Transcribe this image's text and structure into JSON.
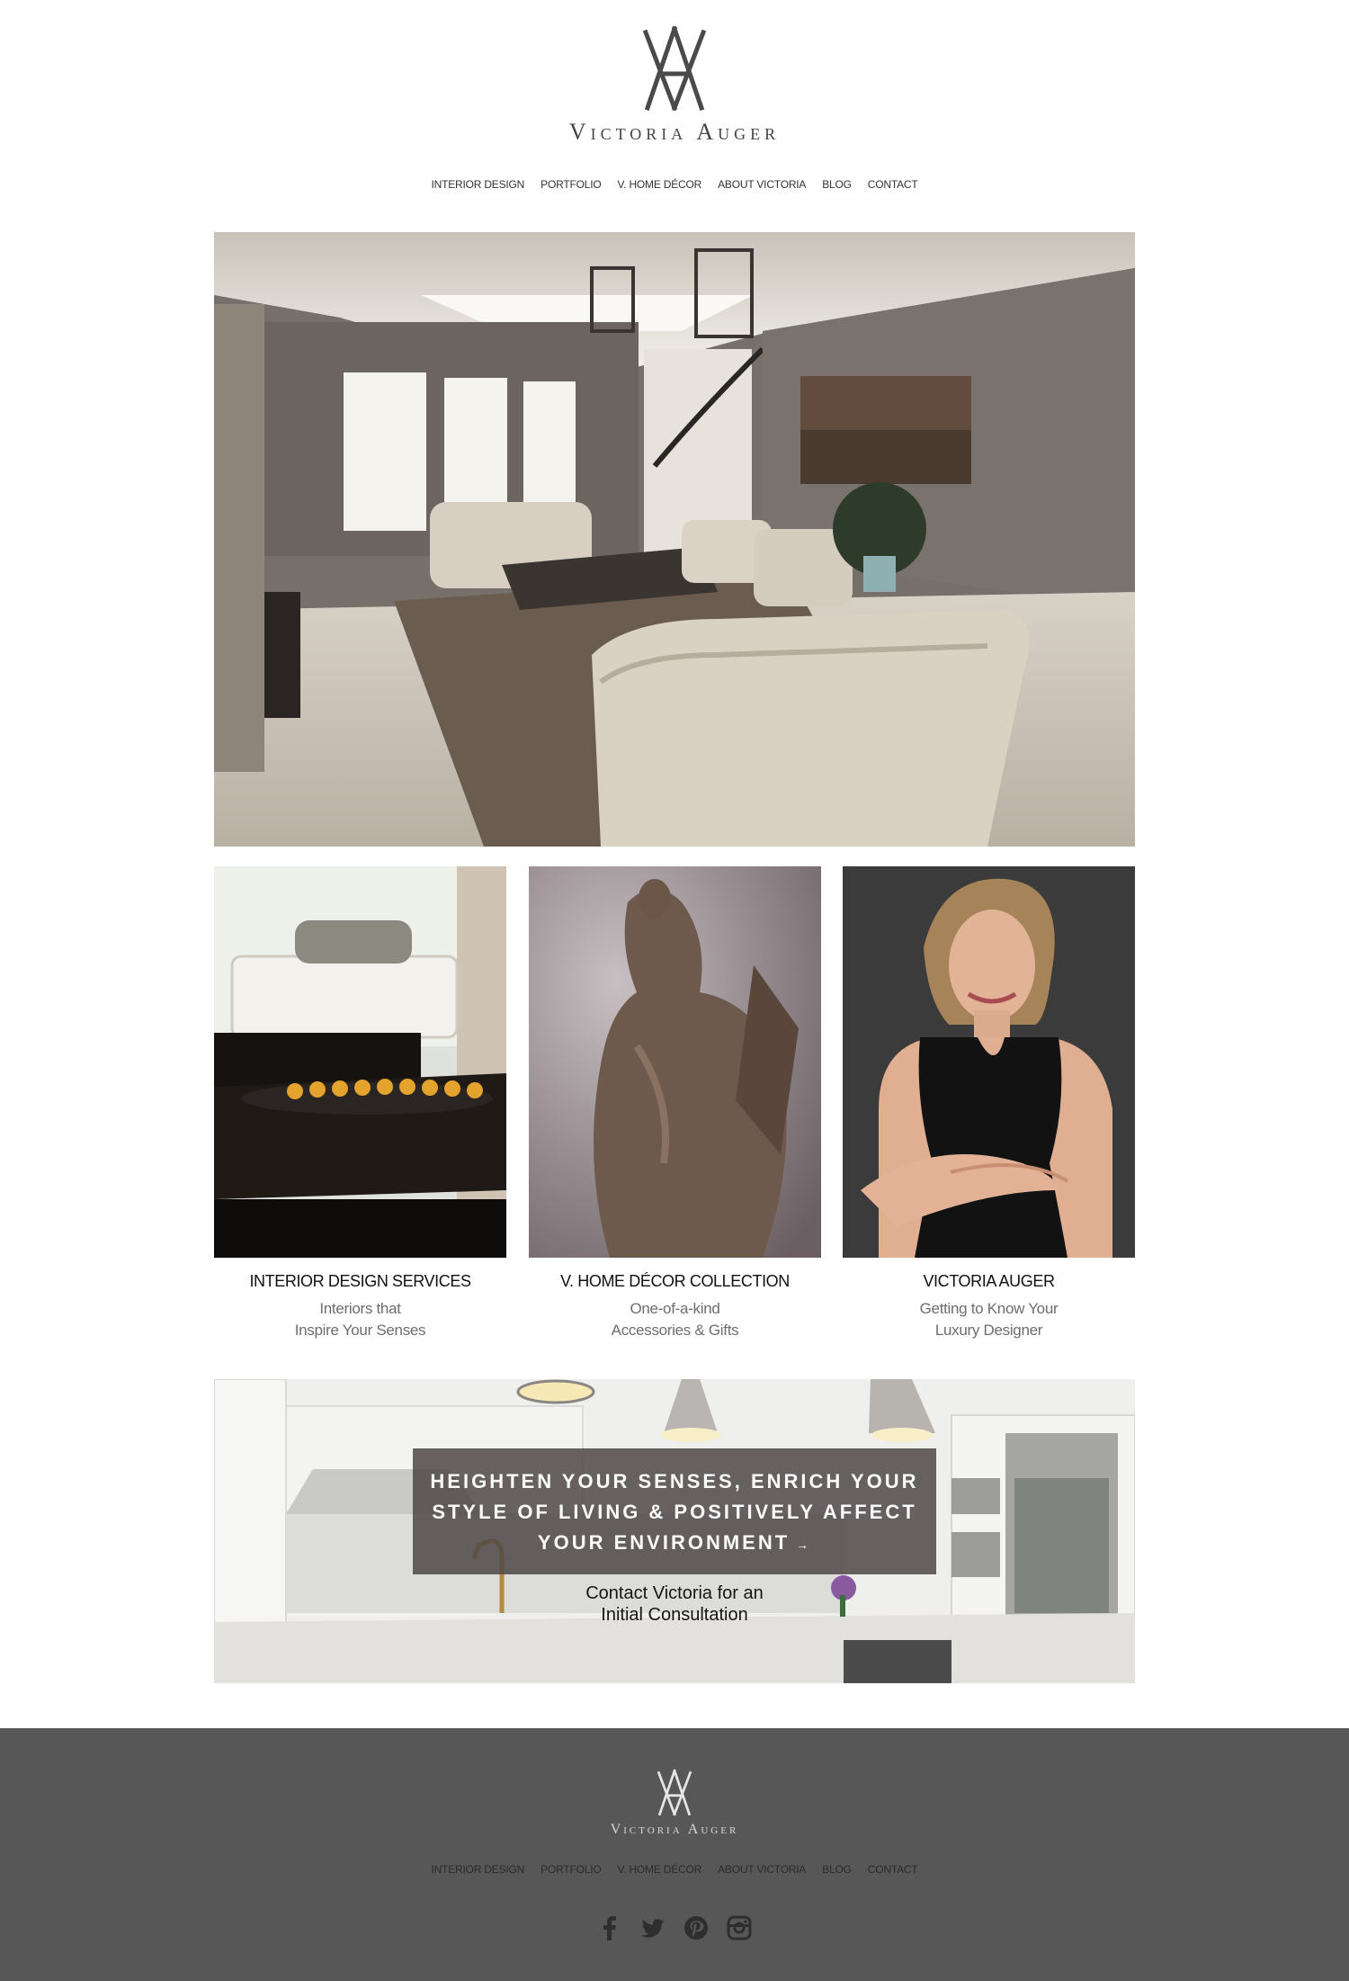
{
  "brand": {
    "name": "Victoria Auger",
    "monogram": "VA"
  },
  "nav": {
    "items": [
      "INTERIOR DESIGN",
      "PORTFOLIO",
      "V. HOME DÉCOR",
      "ABOUT VICTORIA",
      "BLOG",
      "CONTACT"
    ]
  },
  "hero": {
    "image": "living-room-photo"
  },
  "cards": [
    {
      "title": "INTERIOR DESIGN SERVICES",
      "sub_line1": "Interiors that",
      "sub_line2": "Inspire Your Senses",
      "image": "dining-table-photo"
    },
    {
      "title": "V. HOME DÉCOR COLLECTION",
      "sub_line1": "One-of-a-kind",
      "sub_line2": "Accessories & Gifts",
      "image": "statue-photo"
    },
    {
      "title": "VICTORIA AUGER",
      "sub_line1": "Getting to Know Your",
      "sub_line2": "Luxury Designer",
      "image": "designer-portrait-photo"
    }
  ],
  "banner": {
    "headline": "HEIGHTEN YOUR SENSES, ENRICH YOUR\nSTYLE OF LIVING & POSITIVELY AFFECT\nYOUR ENVIRONMENT",
    "arrow": "→",
    "link": "Contact Victoria for an\nInitial Consultation",
    "image": "kitchen-photo"
  },
  "footer": {
    "name": "Victoria Auger",
    "nav": [
      "INTERIOR DESIGN",
      "PORTFOLIO",
      "V. HOME DÉCOR",
      "ABOUT VICTORIA",
      "BLOG",
      "CONTACT"
    ],
    "social": [
      "facebook-icon",
      "twitter-icon",
      "pinterest-icon",
      "instagram-icon"
    ]
  },
  "colors": {
    "footer_bg": "#575757",
    "cta_box": "#4e4846",
    "text_dark": "#111111",
    "text_muted": "#6d6d6d"
  }
}
